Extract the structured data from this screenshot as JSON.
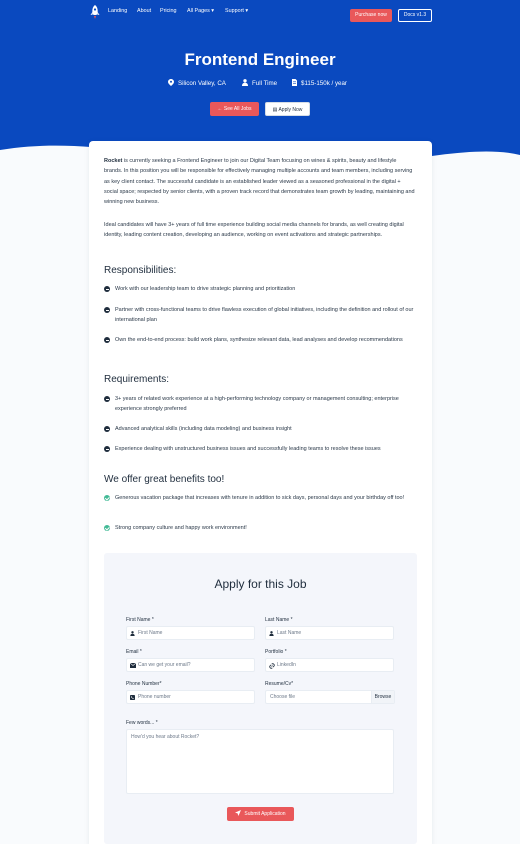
{
  "nav": {
    "links": [
      "Landing",
      "About",
      "Pricing",
      "All Pages",
      "Support"
    ],
    "purchase_label": "Purchase now",
    "docs_label": "Docs v1.3"
  },
  "hero": {
    "title": "Frontend Engineer",
    "location": "Silicon Valley, CA",
    "job_type": "Full Time",
    "salary": "$115-150k / year",
    "see_all_label": "See All Jobs",
    "apply_now_label": "Apply Now"
  },
  "intro": {
    "company": "Rocket",
    "paragraph1": "is currently seeking a Frontend Engineer to join our Digital Team focusing on wines & spirits, beauty and lifestyle brands. In this position you will be responsible for effectively managing multiple accounts and team members, including serving as key client contact. The successful candidate is an established leader viewed as a seasoned professional in the digital + social space; respected by senior clients, with a proven track record that demonstrates team growth by leading, maintaining and winning new business.",
    "paragraph2": "Ideal candidates will have 3+ years of full time experience building social media channels for brands, as well creating digital identity, leading content creation, developing an audience, working on event activations and strategic partnerships."
  },
  "responsibilities": {
    "heading": "Responsibilities:",
    "items": [
      "Work with our leadership team to drive strategic planning and prioritization",
      "Partner with cross-functional teams to drive flawless execution of global initiatives, including the definition and rollout of our international plan",
      "Own the end-to-end process: build work plans, synthesize relevant data, lead analyses and develop recommendations"
    ]
  },
  "requirements": {
    "heading": "Requirements:",
    "items": [
      "3+ years of related work experience at a high-performing technology company or management consulting; enterprise experience strongly preferred",
      "Advanced analytical skills (including data modeling) and business insight",
      "Experience dealing with unstructured business issues and successfully leading teams to resolve these issues"
    ]
  },
  "benefits": {
    "heading": "We offer great benefits too!",
    "items": [
      "Generous vacation package that increases with tenure in addition to sick days, personal days and your birthday off too!",
      "Strong company culture and happy work environment!"
    ]
  },
  "form": {
    "title": "Apply for this Job",
    "first_name_label": "First Name *",
    "first_name_placeholder": "First Name",
    "last_name_label": "Last Name *",
    "last_name_placeholder": "Last Name",
    "email_label": "Email *",
    "email_placeholder": "Can we get your email?",
    "portfolio_label": "Portfolio *",
    "portfolio_placeholder": "LinkedIn",
    "phone_label": "Phone Number*",
    "phone_placeholder": "Phone number",
    "resume_label": "Resume/Cv*",
    "resume_placeholder": "Choose file",
    "browse_label": "Browse",
    "few_words_label": "Few words... *",
    "few_words_placeholder": "How'd you hear about Rocket?",
    "submit_label": "Submit Application"
  },
  "colors": {
    "hero_blue": "#0a49bf",
    "accent_red": "#e9585a",
    "check_green": "#42ba96"
  }
}
